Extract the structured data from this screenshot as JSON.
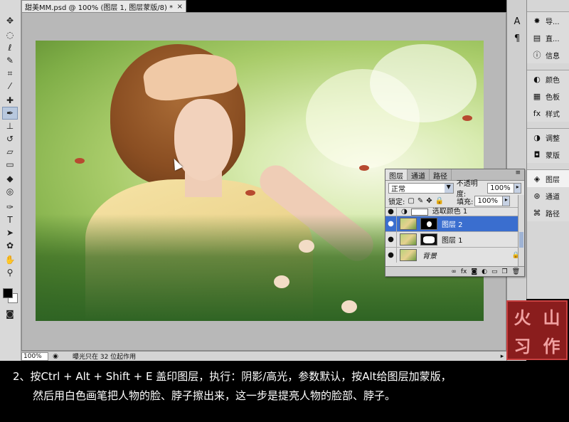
{
  "document": {
    "tab_title": "甜美MM.psd @ 100% (图层 1, 图层蒙版/8) *",
    "close_glyph": "×"
  },
  "tools": [
    "move-tool",
    "marquee-tool",
    "lasso-tool",
    "quick-select-tool",
    "crop-tool",
    "eyedropper-tool",
    "healing-brush-tool",
    "brush-tool",
    "clone-stamp-tool",
    "history-brush-tool",
    "eraser-tool",
    "gradient-tool",
    "blur-tool",
    "dodge-tool",
    "pen-tool",
    "type-tool",
    "path-select-tool",
    "shape-tool",
    "hand-tool",
    "zoom-tool"
  ],
  "status": {
    "zoom": "100%",
    "message": "曝光只在 32 位起作用"
  },
  "dock_icons": {
    "a": "A",
    "b": "¶"
  },
  "panels": {
    "group1": [
      {
        "icon": "navigator-icon",
        "label": "导..."
      },
      {
        "icon": "histogram-icon",
        "label": "直..."
      },
      {
        "icon": "info-icon",
        "label": "信息"
      }
    ],
    "group2": [
      {
        "icon": "color-icon",
        "label": "颜色"
      },
      {
        "icon": "swatches-icon",
        "label": "色板"
      },
      {
        "icon": "styles-icon",
        "label": "样式"
      }
    ],
    "group3": [
      {
        "icon": "adjustments-icon",
        "label": "调整"
      },
      {
        "icon": "masks-icon",
        "label": "蒙版"
      }
    ],
    "group4": [
      {
        "icon": "layers-icon",
        "label": "图层"
      },
      {
        "icon": "channels-icon",
        "label": "通道"
      },
      {
        "icon": "paths-icon",
        "label": "路径"
      }
    ]
  },
  "layers_panel": {
    "tabs": [
      "图层",
      "通道",
      "路径"
    ],
    "blend_mode": "正常",
    "opacity_label": "不透明度:",
    "opacity_value": "100%",
    "lock_label": "锁定:",
    "fill_label": "填充:",
    "fill_value": "100%",
    "layers": [
      {
        "name": "选取颜色 1",
        "visible": true,
        "selected": false,
        "partial": true
      },
      {
        "name": "图层 2",
        "visible": true,
        "selected": true
      },
      {
        "name": "图层 1",
        "visible": true,
        "selected": false
      },
      {
        "name": "背景",
        "visible": true,
        "selected": false,
        "locked": true
      }
    ]
  },
  "seal": {
    "chars": [
      "火",
      "山",
      "习",
      "作"
    ]
  },
  "caption": {
    "line1": "2、按Ctrl + Alt + Shift + E 盖印图层，执行：阴影/高光，参数默认，按Alt给图层加蒙版，",
    "line2": "然后用白色画笔把人物的脸、脖子擦出来，这一步是提亮人物的脸部、脖子。"
  },
  "colors": {
    "selection_blue": "#3a6ecf",
    "foreground": "#000000",
    "background": "#ffffff",
    "seal_red": "#8a1d1d"
  }
}
